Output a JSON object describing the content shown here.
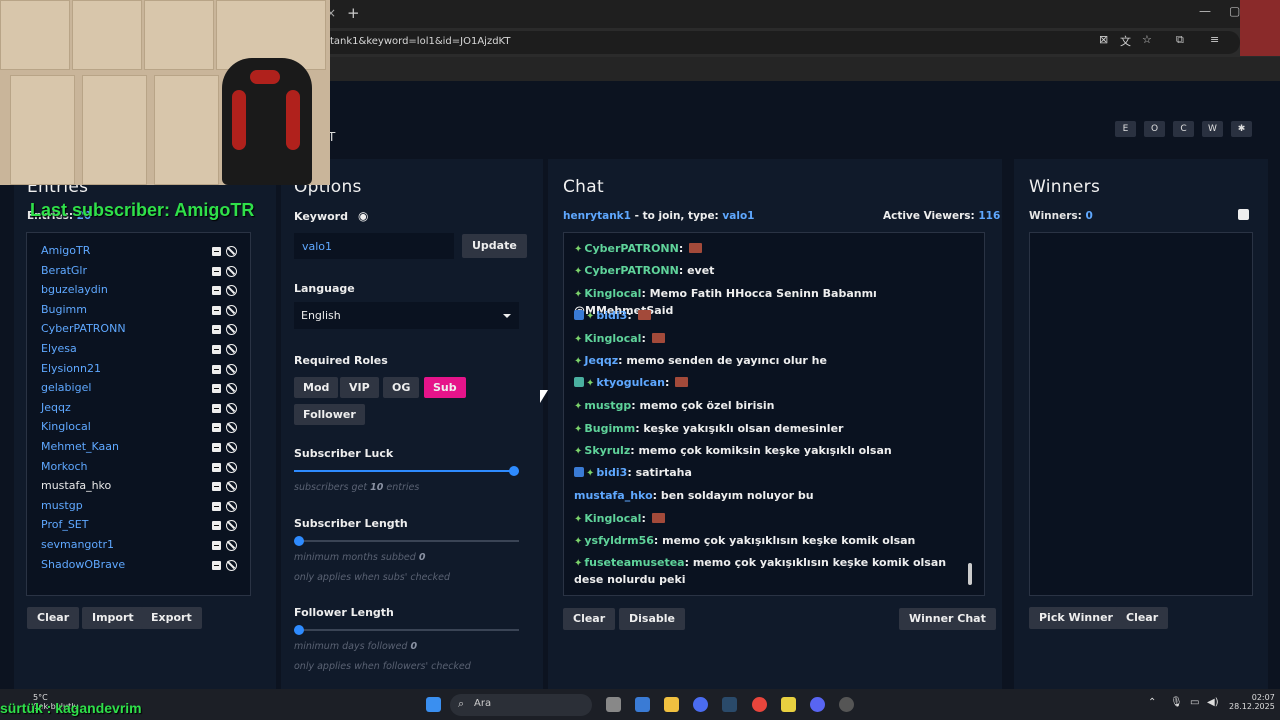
{
  "browser": {
    "url": "tank1&keyword=lol1&id=JO1AjzdKT",
    "tab_close": "×",
    "tab_new": "+",
    "win_controls": [
      "—",
      "▢"
    ]
  },
  "brand_suffix": "T",
  "theme_buttons": [
    "E",
    "O",
    "C",
    "W",
    "✱"
  ],
  "entries": {
    "title": "Entries",
    "count_label": "Entries:",
    "count": "20",
    "names": [
      "AmigoTR",
      "BeratGlr",
      "bguzelaydin",
      "Bugimm",
      "CyberPATRONN",
      "Elyesa",
      "Elysionn21",
      "gelabigel",
      "Jeqqz",
      "Kinglocal",
      "Mehmet_Kaan",
      "Morkoch",
      "mustafa_hko",
      "mustgp",
      "Prof_SET",
      "sevmangotr1",
      "ShadowOBrave"
    ],
    "buttons": {
      "clear": "Clear",
      "import": "Import",
      "export": "Export"
    }
  },
  "options": {
    "title": "Options",
    "keyword_label": "Keyword",
    "keyword_value": "valo1",
    "update": "Update",
    "language_label": "Language",
    "language_value": "English",
    "roles_label": "Required Roles",
    "roles": [
      "Mod",
      "VIP",
      "OG",
      "Sub",
      "Follower"
    ],
    "active_role": "Sub",
    "sub_luck_label": "Subscriber Luck",
    "sub_luck_hint_pre": "subscribers get",
    "sub_luck_value": "10",
    "sub_luck_hint_post": "entries",
    "sub_luck_fraction": 1.0,
    "sub_length_label": "Subscriber Length",
    "sub_length_hint_pre": "minimum months subbed",
    "sub_length_value": "0",
    "sub_length_note": "only applies when subs' checked",
    "sub_length_fraction": 0.0,
    "follower_length_label": "Follower Length",
    "follower_length_hint_pre": "minimum days followed",
    "follower_length_value": "0",
    "follower_length_note": "only applies when followers' checked",
    "follower_length_fraction": 0.0
  },
  "chat": {
    "title": "Chat",
    "channel": "henrytank1",
    "join_text": "- to join, type:",
    "join_keyword": "valo1",
    "viewers_label": "Active Viewers:",
    "viewers": "116",
    "messages": [
      {
        "user": "CyberPATRONN",
        "text": "",
        "emote": true
      },
      {
        "user": "CyberPATRONN",
        "text": "evet",
        "emote": false
      },
      {
        "user": "Kinglocal",
        "text": "Memo Fatih HHocca Seninn Babanmı @MMehmetSaid",
        "emote": false
      },
      {
        "user": "bidi3",
        "text": "",
        "emote": true
      },
      {
        "user": "Kinglocal",
        "text": "",
        "emote": true
      },
      {
        "user": "Jeqqz",
        "text": "memo senden de yayıncı olur he",
        "emote": false
      },
      {
        "user": "ktyogulcan",
        "text": "",
        "emote": true
      },
      {
        "user": "mustgp",
        "text": "memo çok özel birisin",
        "emote": false
      },
      {
        "user": "Bugimm",
        "text": "keşke yakışıklı olsan demesinler",
        "emote": false
      },
      {
        "user": "Skyrulz",
        "text": "memo çok komiksin keşke yakışıklı olsan",
        "emote": false
      },
      {
        "user": "bidi3",
        "text": "satirtaha",
        "emote": false
      },
      {
        "user": "mustafa_hko",
        "text": "ben soldayım noluyor bu",
        "emote": false
      },
      {
        "user": "Kinglocal",
        "text": "",
        "emote": true
      },
      {
        "user": "ysfyldrm56",
        "text": "memo çok yakışıklısın keşke komik olsan",
        "emote": false
      },
      {
        "user": "fuseteamusetea",
        "text": "memo çok yakışıklısın keşke komik olsan dese nolurdu peki",
        "emote": false
      }
    ],
    "buttons": {
      "clear": "Clear",
      "disable": "Disable",
      "winner_chat": "Winner Chat"
    }
  },
  "winners": {
    "title": "Winners",
    "count_label": "Winners:",
    "count": "0",
    "buttons": {
      "pick": "Pick Winner",
      "clear": "Clear"
    }
  },
  "overlay": {
    "last_subscriber": "Last subscriber: AmigoTR",
    "drag_text": "sürtük : kagandevrim"
  },
  "taskbar": {
    "weather_temp": "5°C",
    "weather_desc": "Çok bulutlu",
    "search_placeholder": "Ara",
    "time": "02:07",
    "date": "28.12.2025"
  }
}
